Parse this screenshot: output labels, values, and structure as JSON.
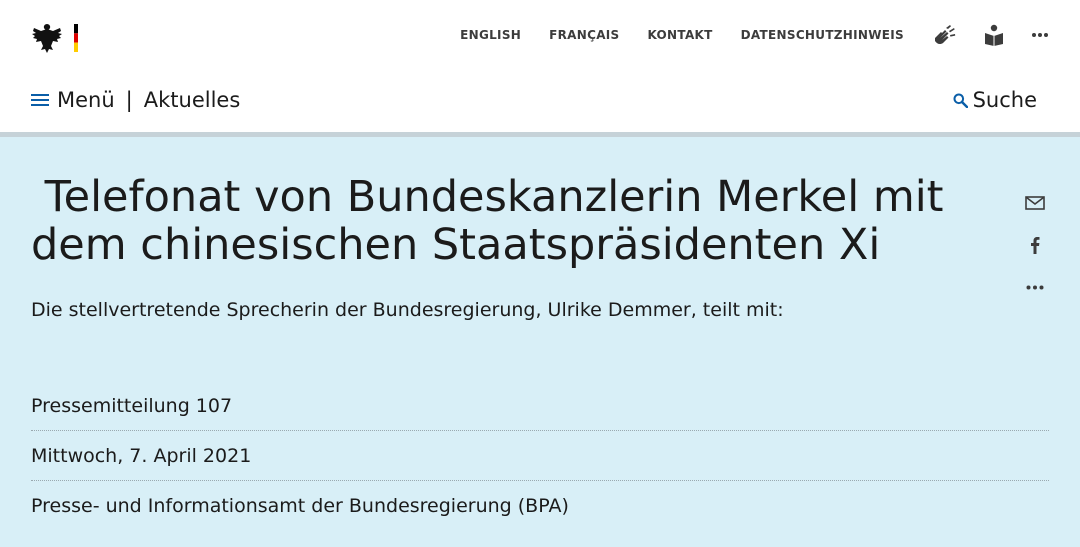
{
  "topnav": {
    "english": "ENGLISH",
    "francais": "FRANÇAIS",
    "kontakt": "KONTAKT",
    "datenschutz": "DATENSCHUTZHINWEIS"
  },
  "navbar": {
    "menu_label": "Menü",
    "separator": "|",
    "section": "Aktuelles",
    "search_label": "Suche"
  },
  "article": {
    "title": " Telefonat von Bundeskanzlerin Merkel mit dem chinesischen Staatspräsidenten Xi",
    "subtitle": "Die stellvertretende Sprecherin der Bundesregierung, Ulrike Demmer, teilt mit:",
    "meta": [
      "Pressemitteilung 107",
      "Mittwoch, 7. April 2021",
      "Presse- und Informationsamt der Bundesregierung (BPA)"
    ]
  },
  "icons": {
    "logo": "federal-eagle-logo",
    "sign_language": "sign-language-icon",
    "easy_language": "easy-language-icon",
    "more": "more-icon",
    "menu": "hamburger-icon",
    "search": "search-icon",
    "mail": "mail-icon",
    "facebook": "facebook-icon",
    "share_more": "more-icon"
  },
  "colors": {
    "content_bg": "#d8eff7",
    "accent_blue": "#0a5ea8",
    "flag_black": "#000000",
    "flag_red": "#dd0000",
    "flag_gold": "#ffcc00"
  }
}
